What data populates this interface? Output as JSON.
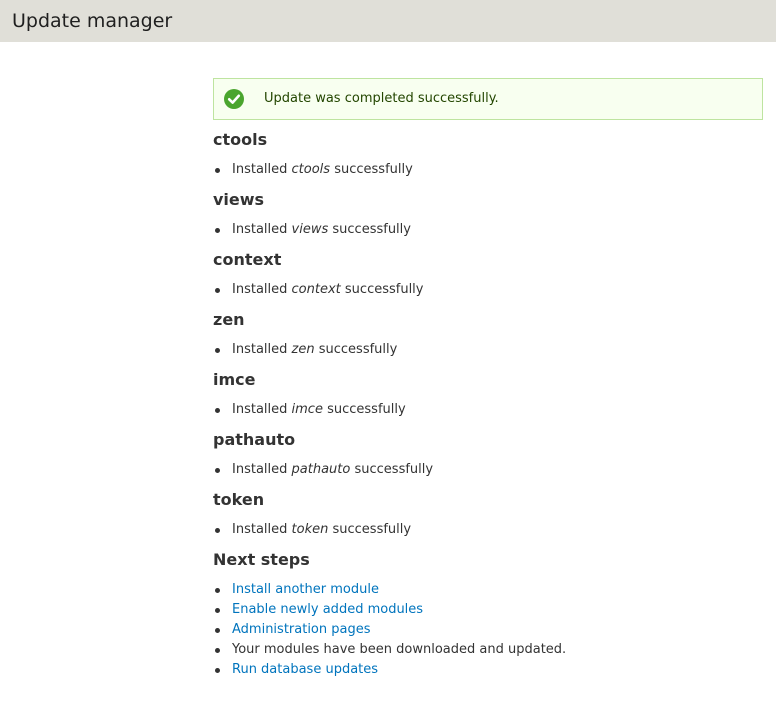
{
  "header": {
    "title": "Update manager"
  },
  "status": {
    "icon": "check-circle-icon",
    "message": "Update was completed successfully.",
    "color": "#4aa52e"
  },
  "modules": [
    {
      "name": "ctools",
      "prefix": "Installed",
      "module": "ctools",
      "suffix": "successfully"
    },
    {
      "name": "views",
      "prefix": "Installed",
      "module": "views",
      "suffix": "successfully"
    },
    {
      "name": "context",
      "prefix": "Installed",
      "module": "context",
      "suffix": "successfully"
    },
    {
      "name": "zen",
      "prefix": "Installed",
      "module": "zen",
      "suffix": "successfully"
    },
    {
      "name": "imce",
      "prefix": "Installed",
      "module": "imce",
      "suffix": "successfully"
    },
    {
      "name": "pathauto",
      "prefix": "Installed",
      "module": "pathauto",
      "suffix": "successfully"
    },
    {
      "name": "token",
      "prefix": "Installed",
      "module": "token",
      "suffix": "successfully"
    }
  ],
  "next_steps": {
    "title": "Next steps",
    "items": [
      {
        "label": "Install another module",
        "link": true
      },
      {
        "label": "Enable newly added modules",
        "link": true
      },
      {
        "label": "Administration pages",
        "link": true
      },
      {
        "label": "Your modules have been downloaded and updated.",
        "link": false
      },
      {
        "label": "Run database updates",
        "link": true
      }
    ]
  },
  "colors": {
    "link": "#0074bd",
    "header_bg": "#e0dfd8",
    "status_bg": "#f8fff0",
    "status_border": "#bee4a0"
  }
}
